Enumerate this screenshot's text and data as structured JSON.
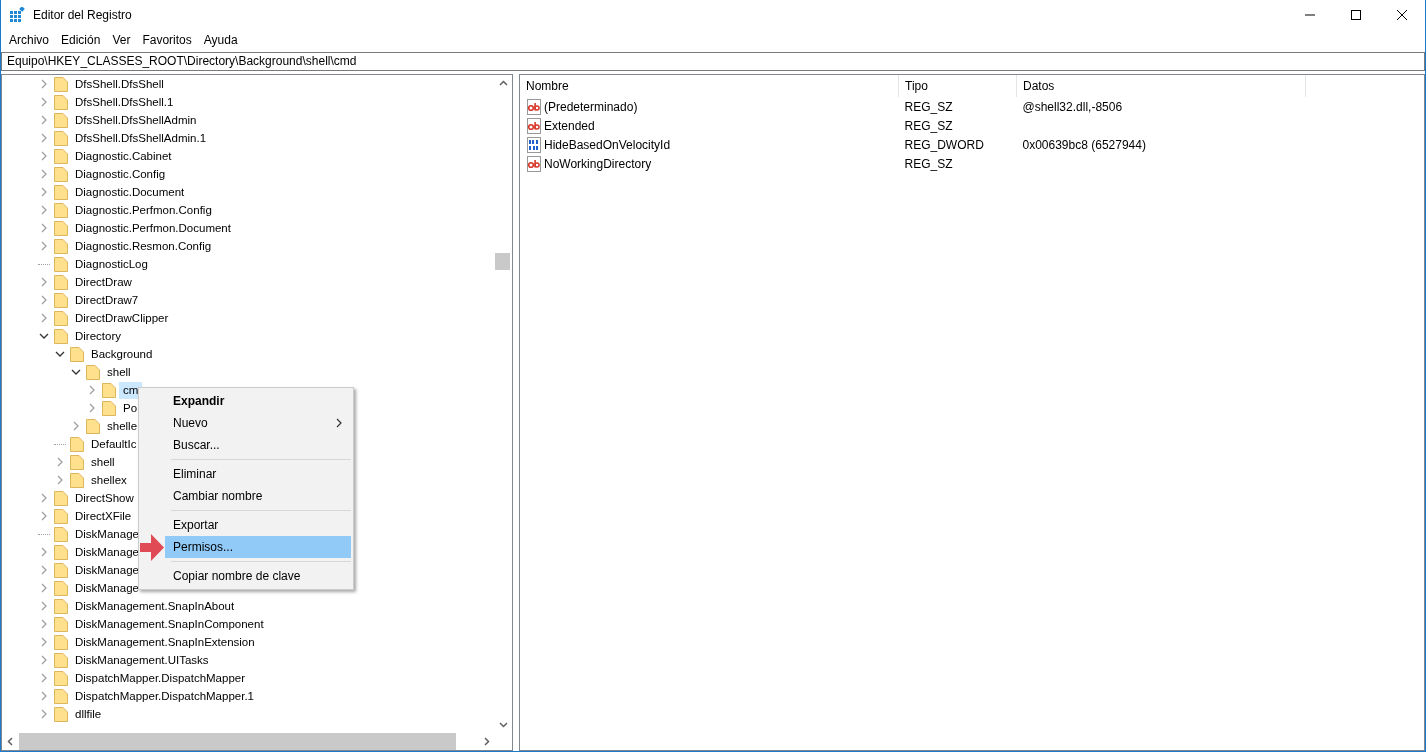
{
  "window": {
    "title": "Editor del Registro"
  },
  "menu_bar": [
    "Archivo",
    "Edición",
    "Ver",
    "Favoritos",
    "Ayuda"
  ],
  "address_bar": {
    "value": "Equipo\\HKEY_CLASSES_ROOT\\Directory\\Background\\shell\\cmd"
  },
  "tree": [
    {
      "label": "DfsShell.DfsShell",
      "has_children": true,
      "expanded": false,
      "selected": false
    },
    {
      "label": "DfsShell.DfsShell.1",
      "has_children": true,
      "expanded": false,
      "selected": false
    },
    {
      "label": "DfsShell.DfsShellAdmin",
      "has_children": true,
      "expanded": false,
      "selected": false
    },
    {
      "label": "DfsShell.DfsShellAdmin.1",
      "has_children": true,
      "expanded": false,
      "selected": false
    },
    {
      "label": "Diagnostic.Cabinet",
      "has_children": true,
      "expanded": false,
      "selected": false
    },
    {
      "label": "Diagnostic.Config",
      "has_children": true,
      "expanded": false,
      "selected": false
    },
    {
      "label": "Diagnostic.Document",
      "has_children": true,
      "expanded": false,
      "selected": false
    },
    {
      "label": "Diagnostic.Perfmon.Config",
      "has_children": true,
      "expanded": false,
      "selected": false
    },
    {
      "label": "Diagnostic.Perfmon.Document",
      "has_children": true,
      "expanded": false,
      "selected": false
    },
    {
      "label": "Diagnostic.Resmon.Config",
      "has_children": true,
      "expanded": false,
      "selected": false
    },
    {
      "label": "DiagnosticLog",
      "has_children": false,
      "selected": false
    },
    {
      "label": "DirectDraw",
      "has_children": true,
      "expanded": false,
      "selected": false
    },
    {
      "label": "DirectDraw7",
      "has_children": true,
      "expanded": false,
      "selected": false
    },
    {
      "label": "DirectDrawClipper",
      "has_children": true,
      "expanded": false,
      "selected": false
    },
    {
      "label": "Directory",
      "has_children": true,
      "expanded": true,
      "selected": false,
      "children": [
        {
          "label": "Background",
          "has_children": true,
          "expanded": true,
          "selected": false,
          "children": [
            {
              "label": "shell",
              "has_children": true,
              "expanded": true,
              "selected": false,
              "children": [
                {
                  "label": "cm",
                  "has_children": true,
                  "expanded": false,
                  "selected": true
                },
                {
                  "label": "Po",
                  "has_children": true,
                  "expanded": false,
                  "selected": false
                }
              ]
            },
            {
              "label": "shelle",
              "has_children": true,
              "expanded": false,
              "selected": false
            }
          ]
        },
        {
          "label": "DefaultIc",
          "has_children": false,
          "selected": false
        },
        {
          "label": "shell",
          "has_children": true,
          "expanded": false,
          "selected": false
        },
        {
          "label": "shellex",
          "has_children": true,
          "expanded": false,
          "selected": false
        }
      ]
    },
    {
      "label": "DirectShow",
      "has_children": true,
      "expanded": false,
      "selected": false
    },
    {
      "label": "DirectXFile",
      "has_children": true,
      "expanded": false,
      "selected": false
    },
    {
      "label": "DiskManage",
      "has_children": false,
      "selected": false
    },
    {
      "label": "DiskManage",
      "has_children": true,
      "expanded": false,
      "selected": false
    },
    {
      "label": "DiskManage",
      "has_children": true,
      "expanded": false,
      "selected": false
    },
    {
      "label": "DiskManage",
      "has_children": true,
      "expanded": false,
      "selected": false
    },
    {
      "label": "DiskManagement.SnapInAbout",
      "has_children": true,
      "expanded": false,
      "selected": false
    },
    {
      "label": "DiskManagement.SnapInComponent",
      "has_children": true,
      "expanded": false,
      "selected": false
    },
    {
      "label": "DiskManagement.SnapInExtension",
      "has_children": true,
      "expanded": false,
      "selected": false
    },
    {
      "label": "DiskManagement.UITasks",
      "has_children": true,
      "expanded": false,
      "selected": false
    },
    {
      "label": "DispatchMapper.DispatchMapper",
      "has_children": true,
      "expanded": false,
      "selected": false
    },
    {
      "label": "DispatchMapper.DispatchMapper.1",
      "has_children": true,
      "expanded": false,
      "selected": false
    },
    {
      "label": "dllfile",
      "has_children": true,
      "expanded": false,
      "selected": false
    }
  ],
  "values_table": {
    "columns": [
      "Nombre",
      "Tipo",
      "Datos"
    ],
    "rows": [
      {
        "kind": "string",
        "name": "(Predeterminado)",
        "type": "REG_SZ",
        "data": "@shell32.dll,-8506"
      },
      {
        "kind": "string",
        "name": "Extended",
        "type": "REG_SZ"
      },
      {
        "kind": "binary",
        "name": "HideBasedOnVelocityId",
        "type": "REG_DWORD",
        "data": "0x00639bc8 (6527944)"
      },
      {
        "kind": "string",
        "name": "NoWorkingDirectory",
        "type": "REG_SZ"
      }
    ]
  },
  "context_menu": {
    "items": [
      {
        "kind": "item",
        "label": "Expandir",
        "default": true,
        "has_submenu": false,
        "selected": false
      },
      {
        "kind": "item",
        "label": "Nuevo",
        "default": false,
        "has_submenu": true,
        "selected": false
      },
      {
        "kind": "item",
        "label": "Buscar...",
        "default": false,
        "has_submenu": false,
        "selected": false
      },
      {
        "kind": "separator"
      },
      {
        "kind": "item",
        "label": "Eliminar",
        "default": false,
        "has_submenu": false,
        "selected": false
      },
      {
        "kind": "item",
        "label": "Cambiar nombre",
        "default": false,
        "has_submenu": false,
        "selected": false
      },
      {
        "kind": "separator"
      },
      {
        "kind": "item",
        "label": "Exportar",
        "default": false,
        "has_submenu": false,
        "selected": false
      },
      {
        "kind": "item",
        "label": "Permisos...",
        "default": false,
        "has_submenu": false,
        "selected": true
      },
      {
        "kind": "separator"
      },
      {
        "kind": "item",
        "label": "Copiar nombre de clave",
        "default": false,
        "has_submenu": false,
        "selected": false
      }
    ]
  }
}
